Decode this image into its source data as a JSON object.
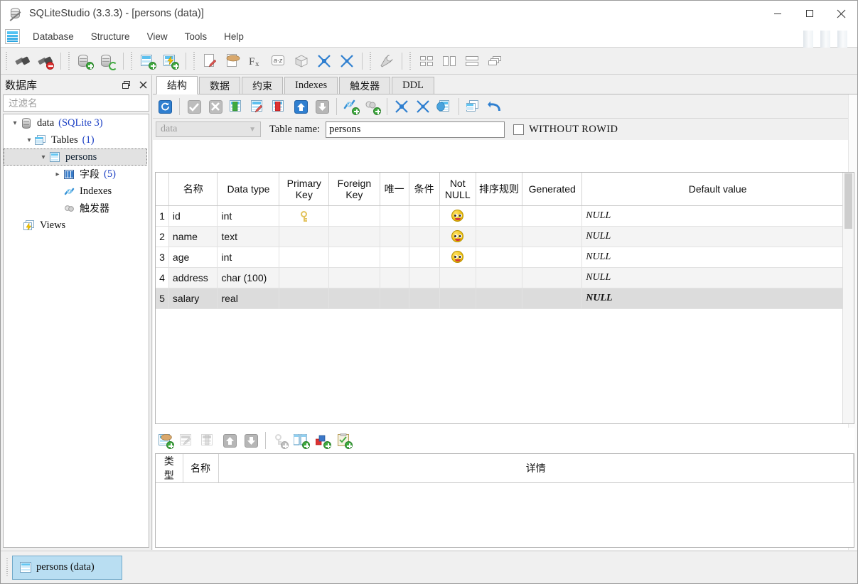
{
  "window": {
    "title": "SQLiteStudio (3.3.3) - [persons (data)]",
    "app_icon": "database-cylinder-icon",
    "minimize": "minimize-icon",
    "maximize": "maximize-icon",
    "close": "close-icon"
  },
  "menubar": {
    "app_icon": "table-grid-icon",
    "items": [
      {
        "label": "Database"
      },
      {
        "label": "Structure"
      },
      {
        "label": "View"
      },
      {
        "label": "Tools"
      },
      {
        "label": "Help"
      }
    ]
  },
  "main_toolbar": {
    "buttons": [
      {
        "name": "connect-database-icon",
        "title": "Connect to the database"
      },
      {
        "name": "disconnect-database-icon",
        "title": "Disconnect from the database"
      },
      {
        "name": "add-database-icon",
        "title": "Add a database"
      },
      {
        "name": "refresh-database-icon",
        "title": "Refresh database schema"
      },
      {
        "name": "create-table-icon",
        "title": "Create a table"
      },
      {
        "name": "create-view-icon",
        "title": "Create a view"
      },
      {
        "name": "open-sql-editor-icon",
        "title": "Open SQL editor"
      },
      {
        "name": "import-icon",
        "title": "Import"
      },
      {
        "name": "function-editor-icon",
        "title": "Custom SQL functions editor"
      },
      {
        "name": "collation-editor-icon",
        "title": "Collations editor"
      },
      {
        "name": "extension-icon",
        "title": "Extensions"
      },
      {
        "name": "collapse-all-icon",
        "title": "Collapse all"
      },
      {
        "name": "expand-all-icon",
        "title": "Expand all"
      },
      {
        "name": "configuration-icon",
        "title": "Open configuration dialog"
      },
      {
        "name": "tile-windows-grid-icon",
        "title": "Tile windows"
      },
      {
        "name": "tile-windows-vertical-icon",
        "title": "Tile vertically"
      },
      {
        "name": "tile-windows-horizontal-icon",
        "title": "Tile horizontally"
      },
      {
        "name": "cascade-windows-icon",
        "title": "Cascade windows"
      }
    ]
  },
  "dock": {
    "title": "数据库",
    "float_button": "float-panel-icon",
    "close_button": "close-panel-icon",
    "filter_placeholder": "过滤名",
    "filter_value": "",
    "tree": [
      {
        "name": "database-node",
        "icon": "database-icon",
        "arrow": "expanded",
        "indent": 0,
        "label": "data",
        "count": "(SQLite 3)",
        "selected": false
      },
      {
        "name": "tables-group-node",
        "icon": "tables-icon",
        "arrow": "expanded",
        "indent": 1,
        "label": "Tables",
        "count": "(1)",
        "selected": false
      },
      {
        "name": "table-persons-node",
        "icon": "table-icon",
        "arrow": "expanded",
        "indent": 2,
        "label": "persons",
        "count": "",
        "selected": true
      },
      {
        "name": "columns-node",
        "icon": "columns-icon",
        "arrow": "collapsed",
        "indent": 3,
        "label": "字段",
        "count": "(5)",
        "selected": false
      },
      {
        "name": "indexes-node",
        "icon": "index-icon",
        "arrow": "none",
        "indent": 3,
        "label": "Indexes",
        "count": "",
        "selected": false
      },
      {
        "name": "triggers-node",
        "icon": "trigger-icon",
        "arrow": "none",
        "indent": 3,
        "label": "触发器",
        "count": "",
        "selected": false
      },
      {
        "name": "views-group-node",
        "icon": "views-icon",
        "arrow": "none",
        "indent": 1,
        "label": "Views",
        "count": "",
        "selected": false
      }
    ]
  },
  "editor": {
    "tabs": [
      {
        "label": "结构",
        "active": true
      },
      {
        "label": "数据",
        "active": false
      },
      {
        "label": "约束",
        "active": false
      },
      {
        "label": "Indexes",
        "active": false
      },
      {
        "label": "触发器",
        "active": false
      },
      {
        "label": "DDL",
        "active": false
      }
    ],
    "structure_toolbar": [
      {
        "name": "refresh-structure-icon",
        "enabled": true
      },
      {
        "name": "commit-structure-icon",
        "enabled": false
      },
      {
        "name": "rollback-structure-icon",
        "enabled": false
      },
      {
        "name": "add-column-icon",
        "enabled": true
      },
      {
        "name": "edit-column-icon",
        "enabled": true
      },
      {
        "name": "delete-column-icon",
        "enabled": true
      },
      {
        "name": "move-column-up-icon",
        "enabled": true
      },
      {
        "name": "move-column-down-icon",
        "enabled": false
      },
      {
        "name": "create-index-icon",
        "enabled": true
      },
      {
        "name": "create-trigger-icon",
        "enabled": true
      },
      {
        "name": "collapse-all-icon",
        "enabled": true
      },
      {
        "name": "expand-all-icon",
        "enabled": true
      },
      {
        "name": "export-table-icon",
        "enabled": true
      },
      {
        "name": "populate-table-icon",
        "enabled": true
      },
      {
        "name": "reset-structure-icon",
        "enabled": true
      }
    ],
    "database_combo": {
      "value": "data",
      "enabled": false
    },
    "table_name_label": "Table name:",
    "table_name_value": "persons",
    "without_rowid": {
      "label": "WITHOUT ROWID",
      "checked": false
    },
    "columns_grid": {
      "headers": [
        "",
        "名称",
        "Data type",
        "Primary Key",
        "Foreign Key",
        "唯一",
        "条件",
        "Not NULL",
        "排序规则",
        "Generated",
        "Default value"
      ],
      "rows": [
        {
          "no": "1",
          "name": "id",
          "type": "int",
          "pk": true,
          "fk": false,
          "unique": false,
          "check": false,
          "notnull": true,
          "collate": "",
          "generated": "",
          "default": "NULL",
          "selected": false
        },
        {
          "no": "2",
          "name": "name",
          "type": "text",
          "pk": false,
          "fk": false,
          "unique": false,
          "check": false,
          "notnull": true,
          "collate": "",
          "generated": "",
          "default": "NULL",
          "selected": false
        },
        {
          "no": "3",
          "name": "age",
          "type": "int",
          "pk": false,
          "fk": false,
          "unique": false,
          "check": false,
          "notnull": true,
          "collate": "",
          "generated": "",
          "default": "NULL",
          "selected": false
        },
        {
          "no": "4",
          "name": "address",
          "type": "char (100)",
          "pk": false,
          "fk": false,
          "unique": false,
          "check": false,
          "notnull": false,
          "collate": "",
          "generated": "",
          "default": "NULL",
          "selected": false
        },
        {
          "no": "5",
          "name": "salary",
          "type": "real",
          "pk": false,
          "fk": false,
          "unique": false,
          "check": false,
          "notnull": false,
          "collate": "",
          "generated": "",
          "default": "NULL",
          "selected": true
        }
      ]
    },
    "constraints_toolbar": [
      {
        "name": "add-constraint-icon",
        "enabled": true
      },
      {
        "name": "edit-constraint-icon",
        "enabled": false
      },
      {
        "name": "delete-constraint-icon",
        "enabled": false
      },
      {
        "name": "move-constraint-up-icon",
        "enabled": true
      },
      {
        "name": "move-constraint-down-icon",
        "enabled": true
      },
      {
        "name": "add-primary-key-icon",
        "enabled": false
      },
      {
        "name": "add-foreign-key-icon",
        "enabled": true
      },
      {
        "name": "add-unique-constraint-icon",
        "enabled": true
      },
      {
        "name": "add-check-constraint-icon",
        "enabled": true
      }
    ],
    "constraints_grid": {
      "headers": [
        "类型",
        "名称",
        "详情"
      ],
      "rows": []
    }
  },
  "taskbar": {
    "buttons": [
      {
        "label": "persons  (data)",
        "icon": "table-icon",
        "active": true
      }
    ]
  },
  "colors": {
    "accent": "#2aa4e0",
    "selection": "#b9def2",
    "tree_count": "#1b3fc4",
    "null_text": "#a8a8a8"
  }
}
